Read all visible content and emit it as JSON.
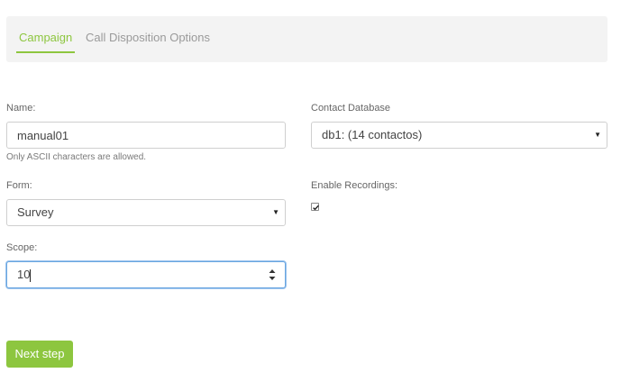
{
  "tabs": [
    {
      "label": "Campaign",
      "active": true
    },
    {
      "label": "Call Disposition Options",
      "active": false
    }
  ],
  "form": {
    "name": {
      "label": "Name:",
      "value": "manual01",
      "help": "Only ASCII characters are allowed."
    },
    "contact_database": {
      "label": "Contact Database",
      "selected": "db1: (14 contactos)"
    },
    "form_select": {
      "label": "Form:",
      "selected": "Survey"
    },
    "enable_recordings": {
      "label": "Enable Recordings:",
      "checked": true
    },
    "scope": {
      "label": "Scope:",
      "value": "10"
    }
  },
  "actions": {
    "next_label": "Next step"
  },
  "colors": {
    "accent": "#8dc63f",
    "focus": "#6aa6e0"
  }
}
